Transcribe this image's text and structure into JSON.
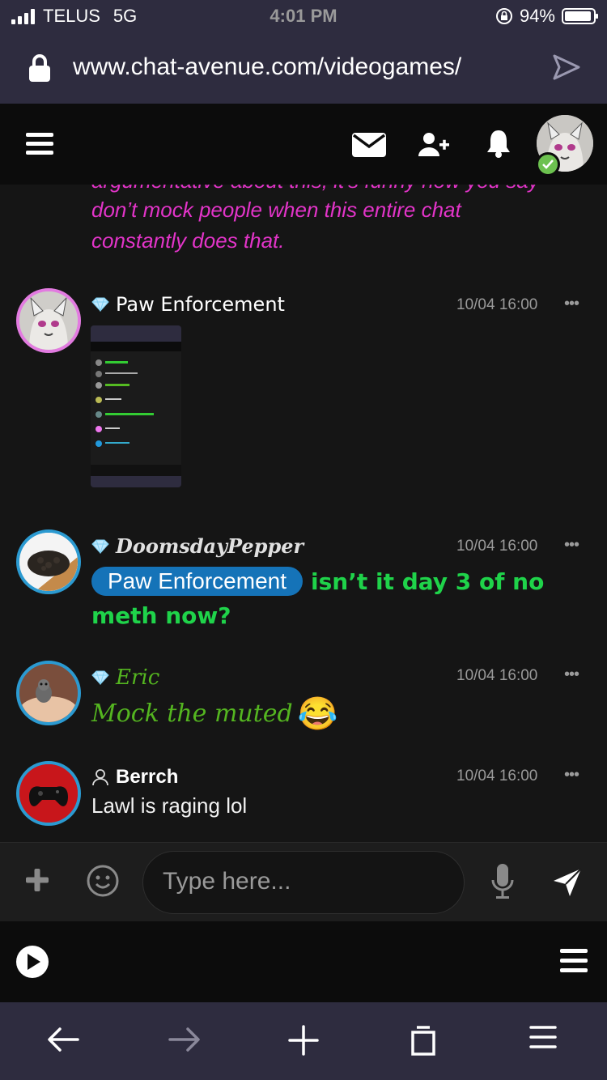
{
  "status": {
    "carrier": "TELUS",
    "network": "5G",
    "time": "4:01 PM",
    "battery": "94%",
    "battery_level": 0.94
  },
  "browser": {
    "url": "www.chat-avenue.com/videogames/"
  },
  "chat": {
    "partial_text_cutoff": "argumentative about this, it's funny how you say",
    "partial_text_line1": "don’t mock people when this entire chat",
    "partial_text_line2": "constantly does that.",
    "messages": [
      {
        "user": "Paw Enforcement",
        "time": "10/04 16:00",
        "dots": "•••",
        "content_type": "screenshot-image"
      },
      {
        "user": "DoomsdayPepper",
        "time": "10/04 16:00",
        "dots": "•••",
        "mention": "Paw Enforcement",
        "text_line1": "isn’t it day 3 of no",
        "text_line2": "meth now?",
        "text_color": "#1fd34a"
      },
      {
        "user": "Eric",
        "time": "10/04 16:00",
        "dots": "•••",
        "text": "Mock the muted",
        "emoji": "😂",
        "text_color": "#54b520"
      },
      {
        "user": "Berrch",
        "time": "10/04 16:00",
        "dots": "•••",
        "text": "Lawl is raging lol"
      }
    ]
  },
  "input": {
    "placeholder": "Type here..."
  },
  "colors": {
    "accent": "#1573b8",
    "pink": "#e234c8",
    "green": "#1fd34a",
    "olive_green": "#54b520"
  },
  "icons": [
    "menu-icon",
    "mail-icon",
    "add-user-icon",
    "bell-icon",
    "lock-icon",
    "go-icon",
    "plus-icon",
    "emoji-icon",
    "mic-icon",
    "send-icon",
    "play-icon",
    "back-icon",
    "forward-icon",
    "new-tab-icon",
    "tabs-icon",
    "browser-menu-icon"
  ]
}
